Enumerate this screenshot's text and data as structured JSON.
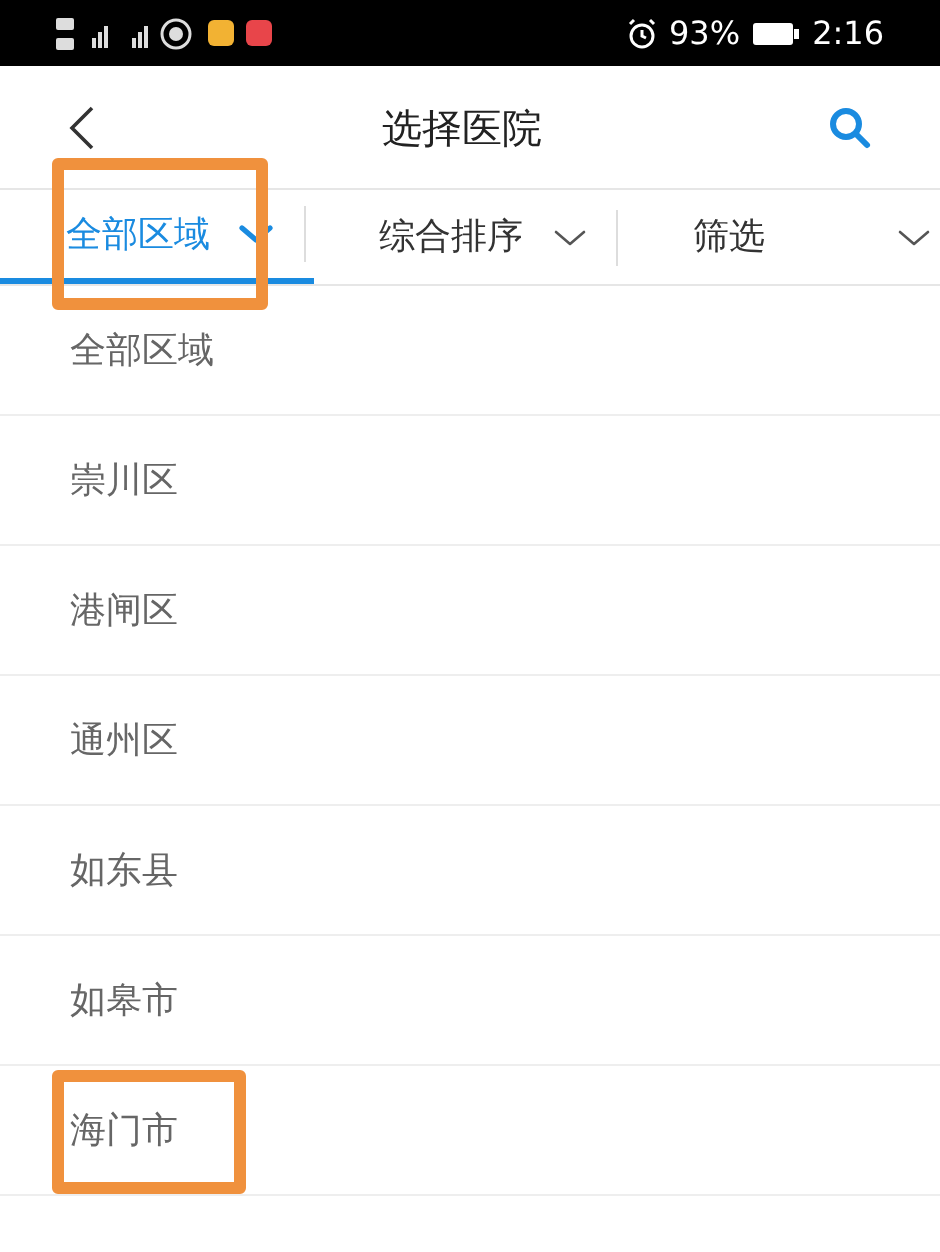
{
  "status_bar": {
    "battery": "93%",
    "time": "2:16"
  },
  "header": {
    "title": "选择医院"
  },
  "filters": [
    {
      "label": "全部区域",
      "selected": true,
      "highlighted": true
    },
    {
      "label": "综合排序",
      "selected": false,
      "highlighted": false
    },
    {
      "label": "筛选",
      "selected": false,
      "highlighted": false
    }
  ],
  "regions": [
    {
      "label": "全部区域",
      "highlighted": false
    },
    {
      "label": "崇川区",
      "highlighted": false
    },
    {
      "label": "港闸区",
      "highlighted": false
    },
    {
      "label": "通州区",
      "highlighted": false
    },
    {
      "label": "如东县",
      "highlighted": false
    },
    {
      "label": "如皋市",
      "highlighted": false
    },
    {
      "label": "海门市",
      "highlighted": true
    }
  ]
}
